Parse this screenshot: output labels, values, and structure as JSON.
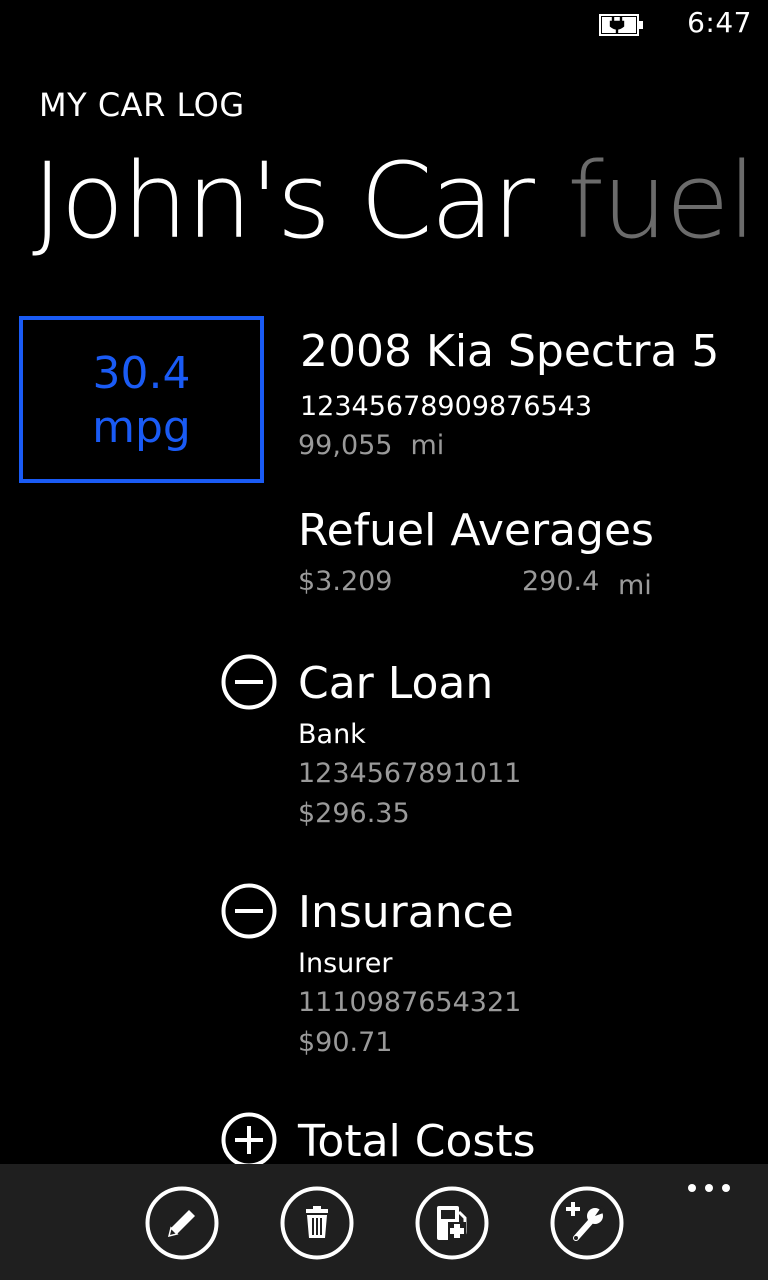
{
  "status_bar": {
    "time": "6:47",
    "battery_icon": "battery-charging-icon"
  },
  "header": {
    "app_title": "MY CAR LOG",
    "pivot_active": "John's Car",
    "pivot_next": "fuel"
  },
  "summary": {
    "mpg_value": "30.4",
    "mpg_unit": "mpg",
    "car_name": "2008 Kia Spectra 5",
    "vin": "12345678909876543",
    "odometer_value": "99,055",
    "odometer_unit": "mi"
  },
  "refuel": {
    "title": "Refuel Averages",
    "avg_price": "$3.209",
    "avg_distance": "290.4",
    "distance_unit": "mi"
  },
  "sections": [
    {
      "title": "Car Loan",
      "provider": "Bank",
      "account": "1234567891011",
      "amount": "$296.35",
      "icon": "collapse-minus-icon"
    },
    {
      "title": "Insurance",
      "provider": "Insurer",
      "account": "1110987654321",
      "amount": "$90.71",
      "icon": "collapse-minus-icon"
    },
    {
      "title": "Total Costs",
      "icon": "expand-plus-icon"
    }
  ],
  "app_bar": {
    "buttons": [
      {
        "icon": "edit-pencil-icon"
      },
      {
        "icon": "delete-trash-icon"
      },
      {
        "icon": "add-fuel-icon"
      },
      {
        "icon": "add-service-icon"
      }
    ],
    "more_icon": "more-ellipsis-icon"
  },
  "colors": {
    "accent": "#1a5bf5",
    "secondary_text": "#9a9a9a",
    "pivot_inactive": "#6b6b6b",
    "app_bar_bg": "#1f1f1f"
  }
}
